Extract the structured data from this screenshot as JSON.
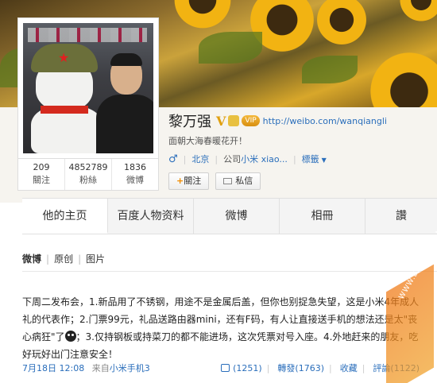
{
  "profile": {
    "name": "黎万强",
    "verified_mark": "V",
    "vip_label": "VIP",
    "url": "http://weibo.com/wanqiangli",
    "intro": "面朝大海春暖花开！",
    "gender_icon": "male-icon",
    "city": "北京",
    "company_prefix": "公司",
    "company_link": "小米 xiao...",
    "tags_label": "標籤",
    "follow_label": "關注",
    "message_label": "私信",
    "counts": [
      {
        "num": "209",
        "label": "關注"
      },
      {
        "num": "4852789",
        "label": "粉絲"
      },
      {
        "num": "1836",
        "label": "微博"
      }
    ]
  },
  "tabs": [
    {
      "label": "他的主页"
    },
    {
      "label": "百度人物资料"
    },
    {
      "label": "微博"
    },
    {
      "label": "相冊"
    },
    {
      "label": "讚"
    }
  ],
  "feed": {
    "subnav": [
      "微博",
      "原创",
      "图片"
    ],
    "post": {
      "text_before_emoji": "下周二发布会，1.新品用了不锈钢，用途不是金属后盖，但你也别捉急失望，这是小米4年成人礼的代表作；2.门票99元，礼品送路由器mini，还有F码，有人让直接送手机的想法还是太\"丧心病狂\"了",
      "text_after_emoji": "；3.仅持钢板或持菜刀的都不能进场，这次凭票对号入座。4.外地赶来的朋友，吃好玩好出门注意安全！",
      "date": "7月18日 12:08",
      "from_prefix": "来自",
      "source": "小米手机3",
      "likes": "(1251)",
      "repost": "轉發(1763)",
      "favorite": "收藏",
      "comment": "評論(1122)"
    }
  },
  "watermark": "WWW.BBKFAN.COM 卡饭"
}
